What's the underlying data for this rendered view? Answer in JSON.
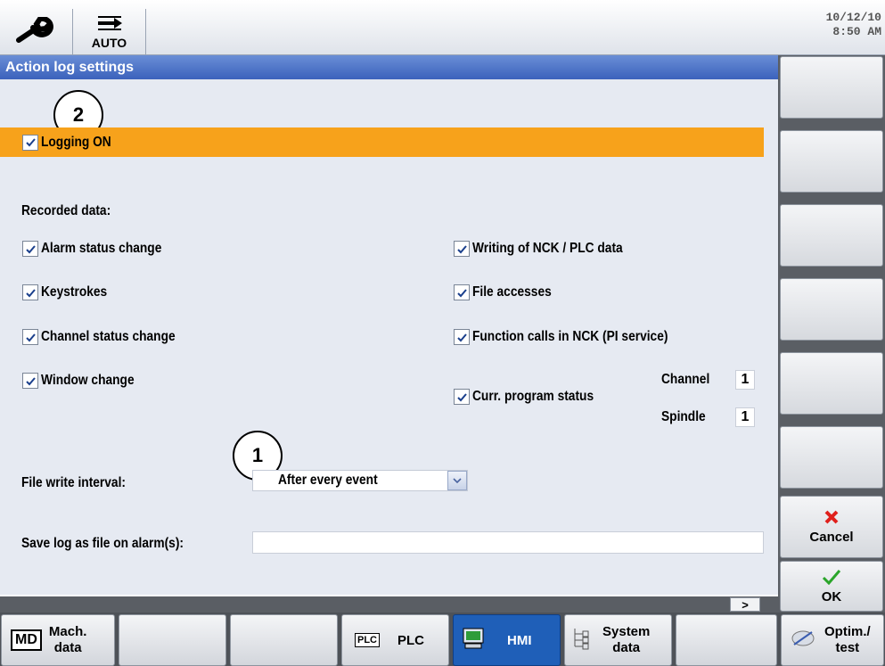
{
  "topbar": {
    "mode_label": "AUTO",
    "date": "10/12/10",
    "time": "8:50 AM"
  },
  "title": "Action log settings",
  "callouts": [
    "1",
    "2"
  ],
  "logging": {
    "label": "Logging ON",
    "checked": true
  },
  "recorded_heading": "Recorded data:",
  "options_left": [
    {
      "label": "Alarm status change",
      "checked": true
    },
    {
      "label": "Keystrokes",
      "checked": true
    },
    {
      "label": "Channel status change",
      "checked": true
    },
    {
      "label": "Window change",
      "checked": true
    }
  ],
  "options_right": [
    {
      "label": "Writing of NCK / PLC data",
      "checked": true
    },
    {
      "label": "File accesses",
      "checked": true
    },
    {
      "label": "Function calls in NCK (PI service)",
      "checked": true
    }
  ],
  "curr_program": {
    "label": "Curr. program status",
    "checked": true,
    "channel_label": "Channel",
    "channel_value": "1",
    "spindle_label": "Spindle",
    "spindle_value": "1"
  },
  "file_write": {
    "label": "File write interval:",
    "value": "After every event"
  },
  "save_log": {
    "label": "Save log as file on alarm(s):",
    "value": ""
  },
  "scroll_right": ">",
  "vsoftkeys": {
    "cancel": "Cancel",
    "ok": "OK"
  },
  "hsoftkeys": {
    "mach_data_1": "Mach.",
    "mach_data_2": "data",
    "md_icon": "MD",
    "plc": "PLC",
    "plc_icon": "PLC",
    "hmi": "HMI",
    "system_data_1": "System",
    "system_data_2": "data",
    "optim_1": "Optim./",
    "optim_2": "test"
  },
  "colors": {
    "title_bg": "#3b62bc",
    "highlight_row": "#f7a21b",
    "selected_softkey": "#1f5fb8",
    "cancel_red": "#e0201c",
    "ok_green": "#2aa52a"
  }
}
